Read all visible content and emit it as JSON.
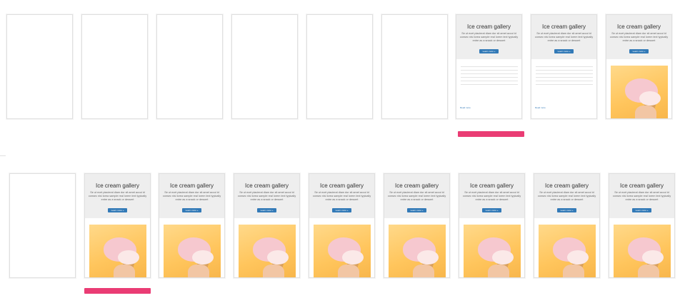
{
  "card": {
    "title": "Ice cream gallery",
    "text": "Se ut ecet placierat diam dor sit amet accui id consec nisi lorea sample real lorem text typically entre as a snack or dessert",
    "button": "Learn more »",
    "link": "Read more"
  },
  "colors": {
    "hero_bg": "#eeeeee",
    "button": "#337ab7",
    "marker": "#ea3c74",
    "photo_bg": "#ffc55c"
  },
  "row1": {
    "states": [
      "blank",
      "blank",
      "blank",
      "blank",
      "blank",
      "blank",
      "text",
      "text",
      "image",
      "image"
    ]
  },
  "row2": {
    "states": [
      "blank",
      "image",
      "image",
      "image",
      "image",
      "image",
      "image",
      "image",
      "image",
      "image"
    ]
  },
  "highlights": {
    "row1_frame": 7,
    "row2_frame": 2
  }
}
